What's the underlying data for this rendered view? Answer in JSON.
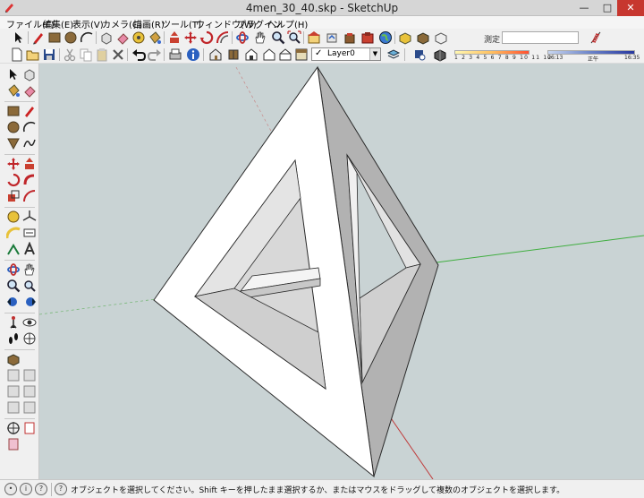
{
  "window": {
    "title": "4men_30_40.skp - SketchUp",
    "minimize": "—",
    "maximize": "□",
    "close": "✕"
  },
  "menu": [
    "ファイル(F)",
    "編集(E)",
    "表示(V)",
    "カメラ(C)",
    "描画(R)",
    "ツール(T)",
    "ウィンドウ(W)",
    "プラグイン",
    "ヘルプ(H)"
  ],
  "toolbar": {
    "measure_label": "測定",
    "layer_name": "Layer0",
    "layer_check": "✓",
    "shadow_months": "1 2 3 4 5 6 7 8 9 10 11 12",
    "shadow_time_start": "06:13",
    "shadow_time_mid": "正午",
    "shadow_time_end": "16:35"
  },
  "status": {
    "icons": [
      "•",
      "i",
      "?"
    ],
    "help_icon": "?",
    "message": "オブジェクトを選択してください。Shift キーを押したまま選択するか、またはマウスをドラッグして複数のオブジェクトを選択します。"
  },
  "colors": {
    "viewport_bg": "#c9d3d4",
    "face_front": "#ffffff",
    "face_inner": "#e2e2e2",
    "face_side": "#b8b8b8",
    "axis_red": "#b04040",
    "axis_green": "#40b040"
  }
}
